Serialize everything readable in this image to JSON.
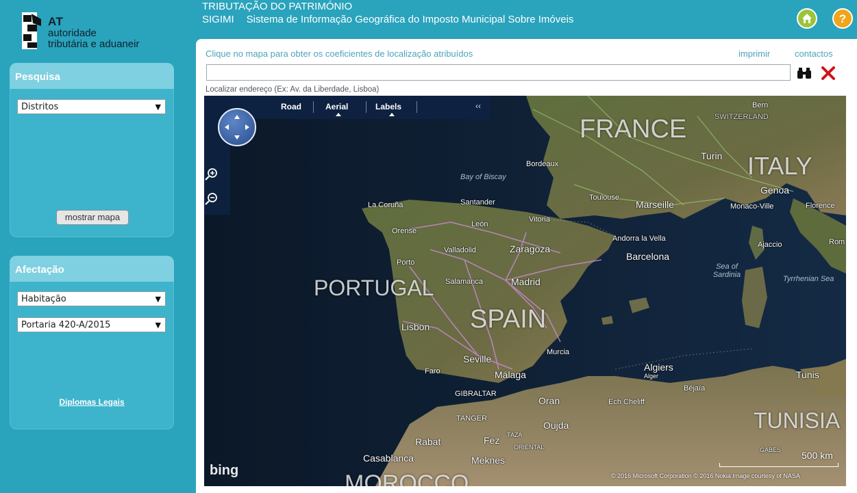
{
  "logo": {
    "short": "AT",
    "line1": "autoridade",
    "line2": "tributária e aduaneir"
  },
  "header": {
    "title": "TRIBUTAÇÃO DO PATRIMÓNIO",
    "app_code": "SIGIMI",
    "app_name": "Sistema de Informação Geográfica do Imposto Municipal Sobre Imóveis",
    "home_icon": "home-icon",
    "help_icon": "help-icon"
  },
  "search_panel": {
    "title": "Pesquisa",
    "district_select": "Distritos",
    "show_map_button": "mostrar mapa"
  },
  "afetacao_panel": {
    "title": "Afectação",
    "use_select": "Habitação",
    "portaria_select": "Portaria 420-A/2015",
    "legal_link": "Diplomas Legais"
  },
  "main": {
    "hint": "Clique no mapa para obter os coeficientes de localização atribuídos",
    "print_link": "imprimir",
    "contacts_link": "contactos",
    "address_value": "",
    "address_hint": "Localizar endereço (Ex: Av. da Liberdade, Lisboa)"
  },
  "map": {
    "toolbar": {
      "road": "Road",
      "aerial": "Aerial",
      "labels": "Labels",
      "collapse": "‹‹"
    },
    "countries": {
      "france": "FRANCE",
      "italy": "ITALY",
      "portugal": "PORTUGAL",
      "spain": "SPAIN",
      "tunisia": "TUNISIA",
      "morocco": "MOROCCO",
      "switzerland": "SWITZERLAND"
    },
    "cities": {
      "bordeaux": "Bordeaux",
      "toulouse": "Toulouse",
      "marseille": "Marseille",
      "turin": "Turin",
      "genoa": "Genoa",
      "monaco": "Monaco-Ville",
      "florence": "Florence",
      "rome": "Rom",
      "la_coruna": "La Coruña",
      "santander": "Santander",
      "vitoria": "Vitoria",
      "leon": "León",
      "orense": "Orense",
      "porto": "Porto",
      "valladolid": "Valladolid",
      "zaragoza": "Zaragoza",
      "andorra": "Andorra la Vella",
      "barcelona": "Barcelona",
      "salamanca": "Salamanca",
      "madrid": "Madrid",
      "lisbon": "Lisbon",
      "murcia": "Murcia",
      "seville": "Seville",
      "faro": "Faro",
      "malaga": "Málaga",
      "algiers": "Algiers",
      "alger": "Alger",
      "ajaccio": "Ajaccio",
      "tunis": "Tunis",
      "bejaia": "Béjaïa",
      "tanger": "TANGER",
      "oran": "Oran",
      "ech_cheliff": "Ech Cheliff",
      "oujda": "Oujda",
      "fez": "Fez",
      "taza": "TAZA",
      "oriental": "ORIENTAL",
      "rabat": "Rabat",
      "casablanca": "Casablanca",
      "meknes": "Meknes",
      "gabes": "GABES",
      "gibraltar": "GIBRALTAR",
      "bern": "Bern"
    },
    "seas": {
      "biscay": "Bay of Biscay",
      "sardinia": "Sea of Sardinia",
      "tyrrhenian": "Tyrrhenian Sea"
    },
    "provider": "bing",
    "scale": "500 km",
    "copyright": "© 2016 Microsoft Corporation  © 2016 Nokia  Image courtesy of NASA"
  },
  "colors": {
    "background": "#2aa3bd",
    "panel": "#3db4cc",
    "link": "#4aa3bc"
  }
}
